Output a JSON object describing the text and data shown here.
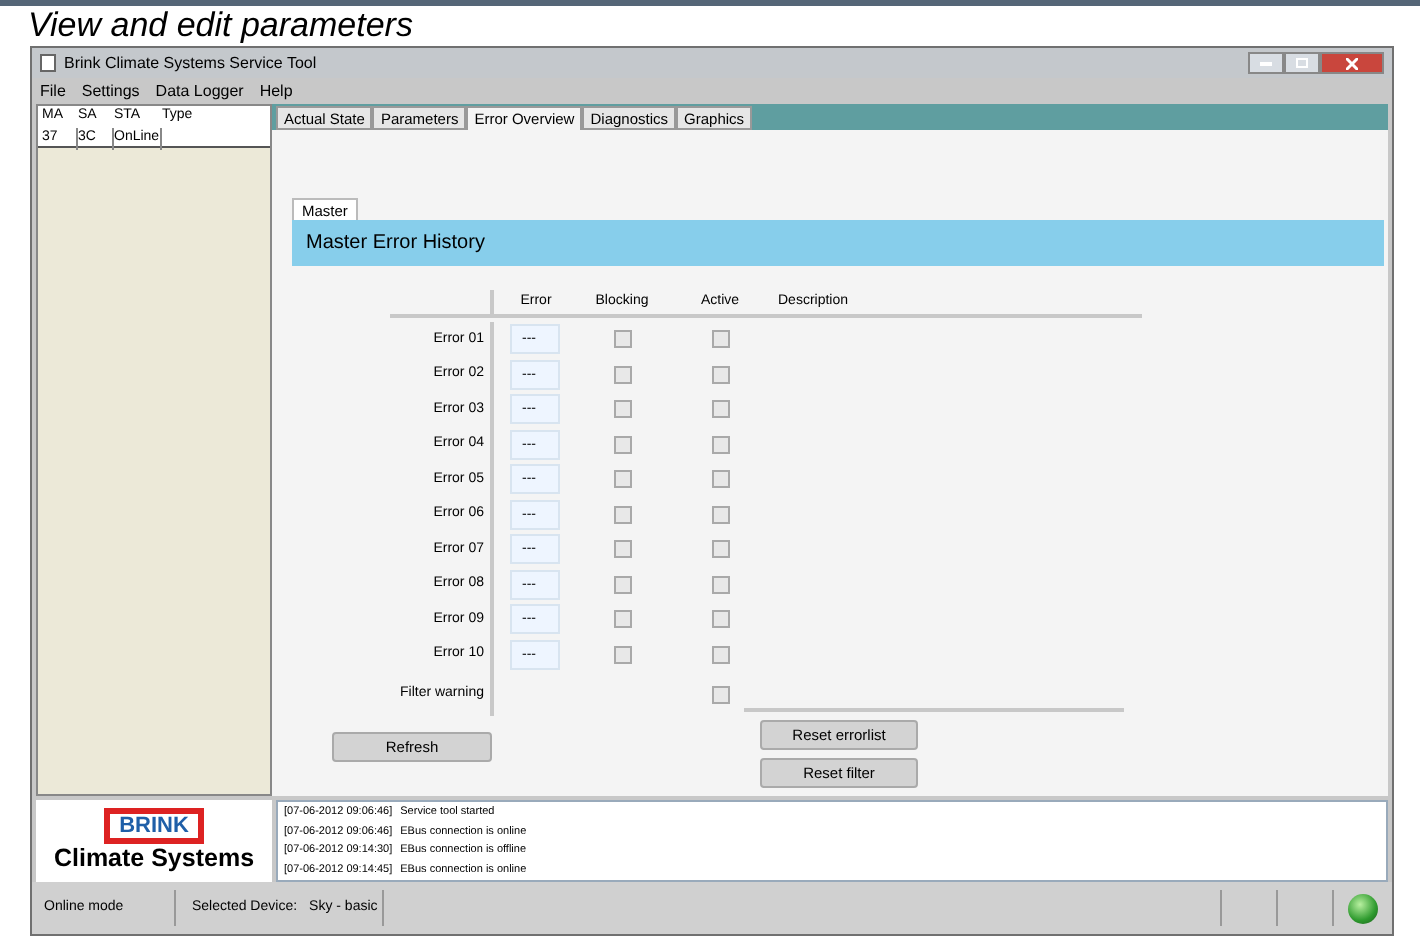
{
  "caption": "View and edit parameters",
  "window": {
    "title": "Brink Climate Systems Service Tool"
  },
  "menu": [
    {
      "label": "File"
    },
    {
      "label": "Settings"
    },
    {
      "label": "Data Logger"
    },
    {
      "label": "Help"
    }
  ],
  "device_table": {
    "columns": [
      "MA",
      "SA",
      "STA",
      "Type"
    ],
    "rows": [
      [
        "37",
        "3C",
        "OnLine",
        ""
      ]
    ]
  },
  "tabs": [
    {
      "label": "Actual State",
      "selected": false
    },
    {
      "label": "Parameters",
      "selected": false
    },
    {
      "label": "Error Overview",
      "selected": true
    },
    {
      "label": "Diagnostics",
      "selected": false
    },
    {
      "label": "Graphics",
      "selected": false
    }
  ],
  "subtabs": [
    {
      "label": "Master",
      "selected": true
    }
  ],
  "section_title": "Master Error History",
  "error_table": {
    "columns": [
      "Error",
      "Blocking",
      "Active",
      "Description"
    ],
    "rows": [
      {
        "label": "Error 01",
        "kind": "error",
        "value": "---",
        "blocking": false,
        "active": false
      },
      {
        "label": "Error 02",
        "kind": "error",
        "value": "---",
        "blocking": false,
        "active": false
      },
      {
        "label": "Error 03",
        "kind": "error",
        "value": "---",
        "blocking": false,
        "active": false
      },
      {
        "label": "Error 04",
        "kind": "error",
        "value": "---",
        "blocking": false,
        "active": false
      },
      {
        "label": "Error 05",
        "kind": "error",
        "value": "---",
        "blocking": false,
        "active": false
      },
      {
        "label": "Error 06",
        "kind": "error",
        "value": "---",
        "blocking": false,
        "active": false
      },
      {
        "label": "Error 07",
        "kind": "error",
        "value": "---",
        "blocking": false,
        "active": false
      },
      {
        "label": "Error 08",
        "kind": "error",
        "value": "---",
        "blocking": false,
        "active": false
      },
      {
        "label": "Error 09",
        "kind": "error",
        "value": "---",
        "blocking": false,
        "active": false
      },
      {
        "label": "Error 10",
        "kind": "error",
        "value": "---",
        "blocking": false,
        "active": false
      },
      {
        "label": "Filter warning",
        "kind": "filter",
        "active": false
      }
    ]
  },
  "buttons": {
    "refresh": "Refresh",
    "reset_errorlist": "Reset errorlist",
    "reset_filter": "Reset filter"
  },
  "logo": {
    "brand": "BRINK",
    "tagline": "Climate Systems"
  },
  "log": [
    {
      "time": "[07-06-2012 09:06:46]",
      "message": "Service tool started"
    },
    {
      "time": "[07-06-2012 09:06:46]",
      "message": "EBus connection is online"
    },
    {
      "time": "[07-06-2012 09:14:30]",
      "message": "EBus connection is offline"
    },
    {
      "time": "[07-06-2012 09:14:45]",
      "message": "EBus connection is online"
    }
  ],
  "status_bar": {
    "mode": "Online mode",
    "device_label": "Selected Device:",
    "device": "Sky - basic",
    "connected": true
  }
}
